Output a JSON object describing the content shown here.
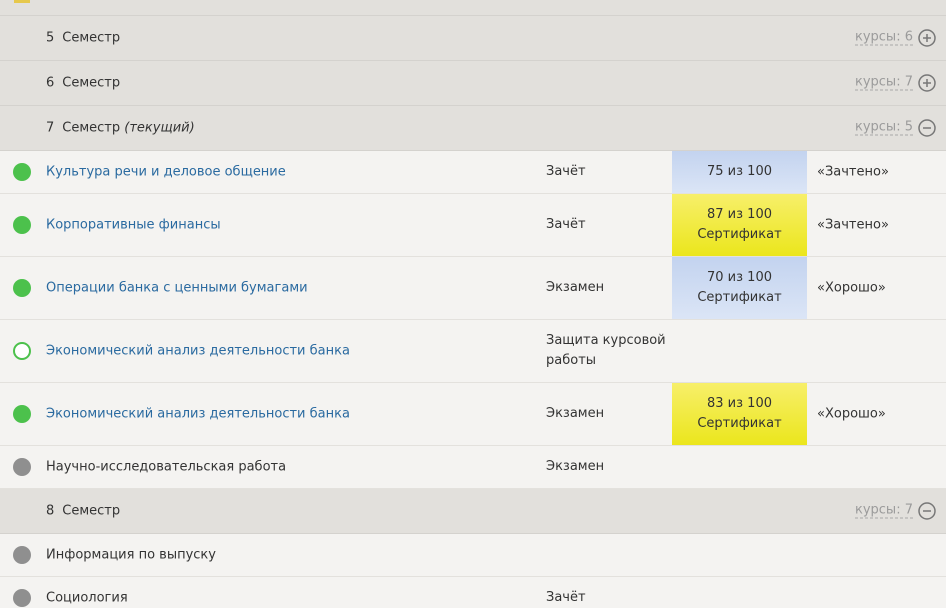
{
  "courses_prefix": "курсы:",
  "semester_word": "Семестр",
  "semesters": [
    {
      "num": "5",
      "current": "",
      "count": "6",
      "state": "collapsed"
    },
    {
      "num": "6",
      "current": "",
      "count": "7",
      "state": "collapsed"
    },
    {
      "num": "7",
      "current": "(текущий)",
      "count": "5",
      "state": "expanded"
    },
    {
      "num": "8",
      "current": "",
      "count": "7",
      "state": "expanded"
    }
  ],
  "courses": [
    {
      "title": "Культура речи и деловое общение",
      "status": "passed",
      "type": "Зачёт",
      "score": "75 из 100",
      "certificate": "",
      "score_style": "blue",
      "grade": "«Зачтено»"
    },
    {
      "title": "Корпоративные финансы",
      "status": "passed",
      "type": "Зачёт",
      "score": "87 из 100",
      "certificate": "Сертификат",
      "score_style": "yellow",
      "grade": "«Зачтено»"
    },
    {
      "title": "Операции банка с ценными бумагами",
      "status": "passed",
      "type": "Экзамен",
      "score": "70 из 100",
      "certificate": "Сертификат",
      "score_style": "blue",
      "grade": "«Хорошо»"
    },
    {
      "title": "Экономический анализ деятельности банка",
      "status": "in-progress",
      "type": "Защита курсовой работы",
      "score": "",
      "certificate": "",
      "score_style": "",
      "grade": ""
    },
    {
      "title": "Экономический анализ деятельности банка",
      "status": "passed",
      "type": "Экзамен",
      "score": "83 из 100",
      "certificate": "Сертификат",
      "score_style": "yellow",
      "grade": "«Хорошо»"
    },
    {
      "title": "Научно-исследовательская работа",
      "status": "inactive",
      "type": "Экзамен",
      "score": "",
      "certificate": "",
      "score_style": "",
      "grade": ""
    },
    {
      "title": "Информация по выпуску",
      "status": "inactive",
      "type": "",
      "score": "",
      "certificate": "",
      "score_style": "",
      "grade": ""
    },
    {
      "title": "Социология",
      "status": "inactive",
      "type": "Зачёт",
      "score": "",
      "certificate": "",
      "score_style": "",
      "grade": ""
    }
  ],
  "colors": {
    "passed": "#4cc14c",
    "inactive": "#8f8f8f",
    "link": "#2a6aa0"
  }
}
